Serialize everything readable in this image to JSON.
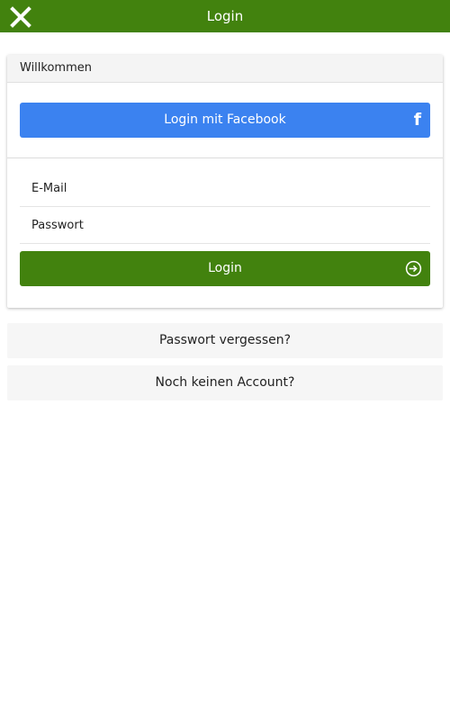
{
  "header": {
    "title": "Login",
    "close_icon": "close-icon",
    "background_color": "#42820e"
  },
  "login_card": {
    "title": "Willkommen",
    "facebook_button": {
      "label": "Login mit Facebook",
      "icon": "facebook-icon",
      "icon_glyph": "f",
      "color": "#3b82f0"
    },
    "email_field": {
      "placeholder": "E-Mail",
      "value": ""
    },
    "password_field": {
      "placeholder": "Passwort",
      "value": ""
    },
    "login_button": {
      "label": "Login",
      "icon": "sign-in-icon",
      "color": "#42820e"
    }
  },
  "links": {
    "forgot_password": "Passwort vergessen?",
    "no_account": "Noch keinen Account?"
  }
}
